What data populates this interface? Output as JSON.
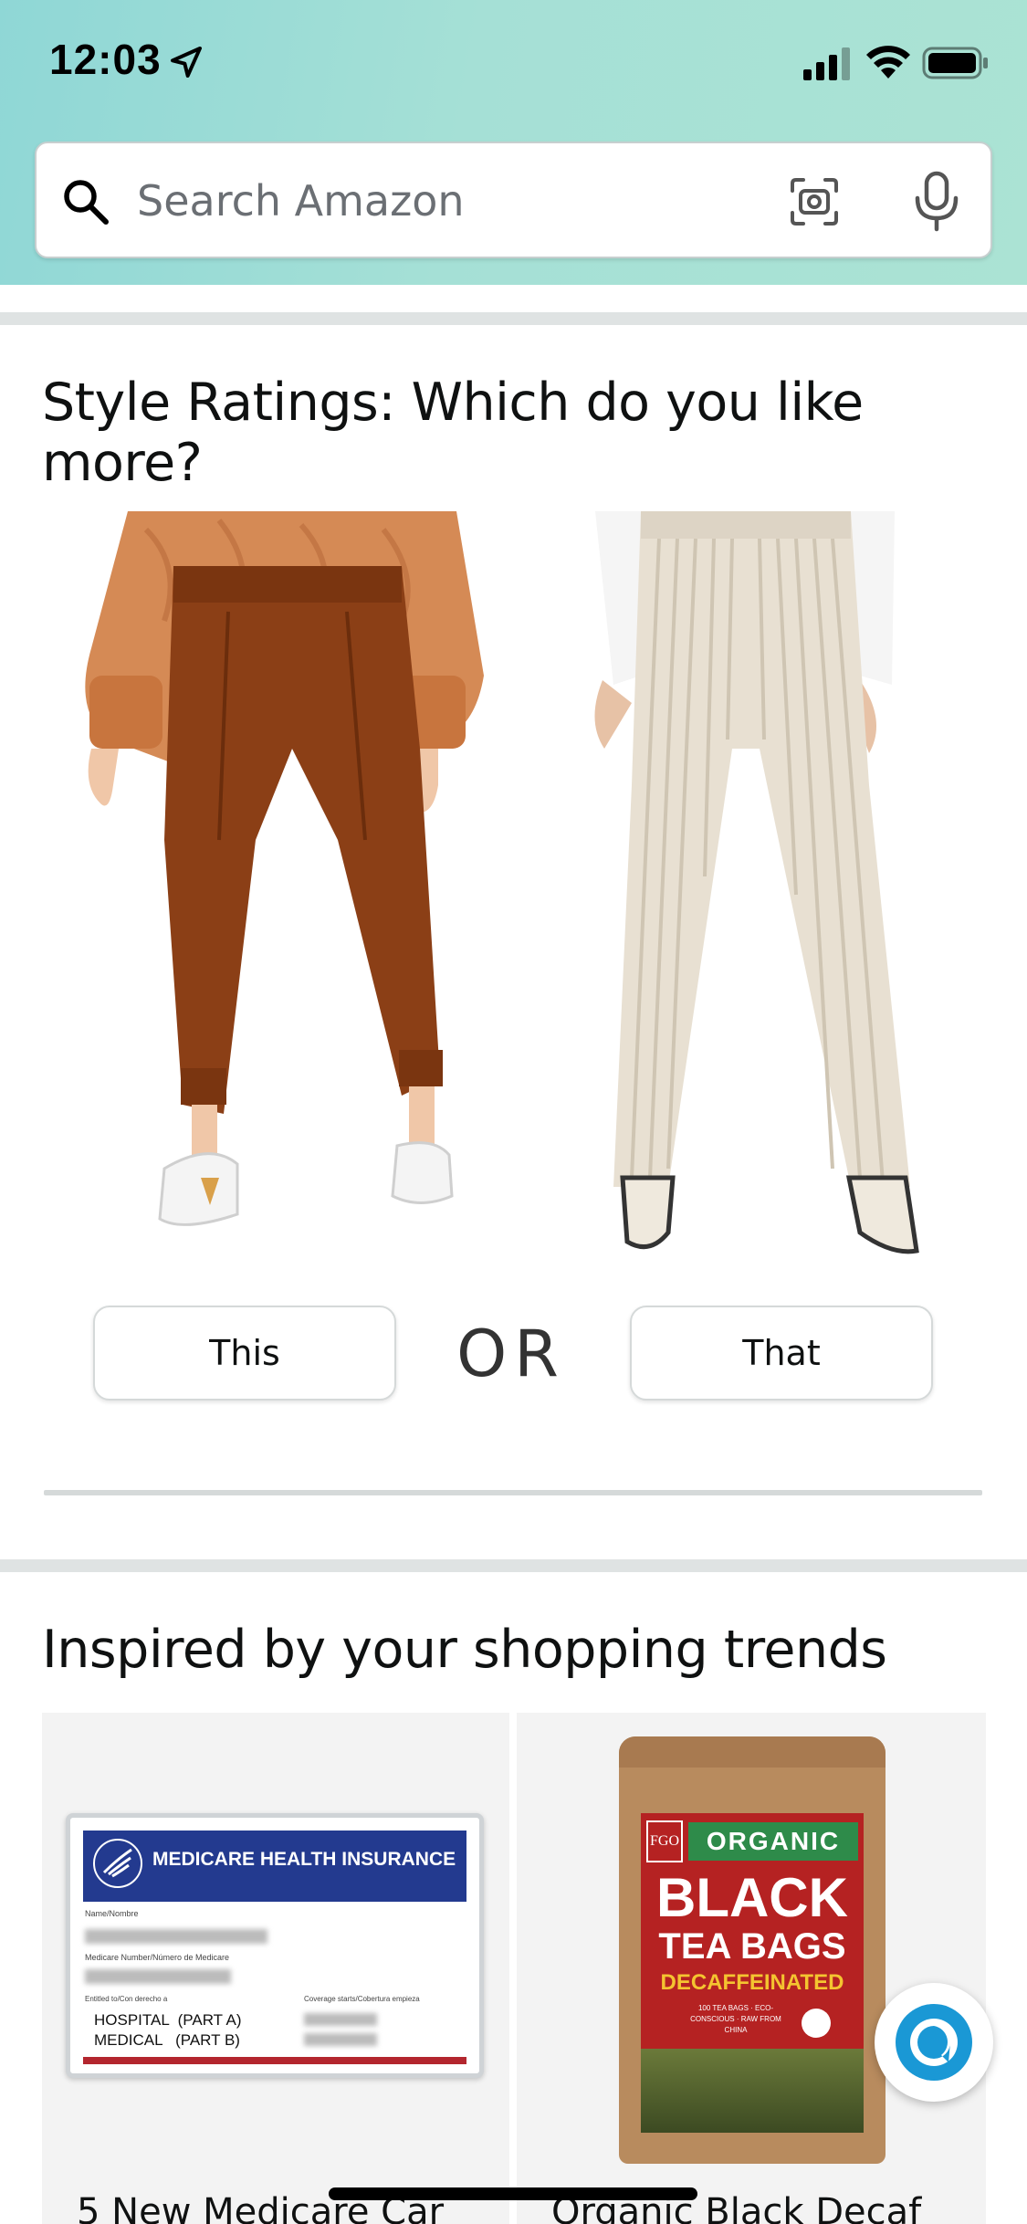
{
  "status_bar": {
    "time": "12:03"
  },
  "search": {
    "placeholder": "Search Amazon"
  },
  "style_ratings": {
    "title": "Style Ratings: Which do you like more?",
    "option_a_label": "This",
    "or_label": "OR",
    "option_b_label": "That"
  },
  "inspired": {
    "title": "Inspired by your shopping trends",
    "items": [
      {
        "caption": "5 New Medicare Car",
        "card_header": "MEDICARE HEALTH INSURANCE",
        "card_name_label": "Name/Nombre",
        "card_number_label": "Medicare Number/Número de Medicare",
        "card_entitled_label": "Entitled to/Con derecho a",
        "card_coverage_label": "Coverage starts/Cobertura empieza",
        "card_line1": "HOSPITAL  (PART A)",
        "card_line2": "MEDICAL   (PART B)"
      },
      {
        "caption": "Organic Black Decaf",
        "bag_brand": "FGO",
        "bag_line1": "ORGANIC",
        "bag_line2": "BLACK",
        "bag_line3": "TEA BAGS",
        "bag_line4": "DECAFFEINATED",
        "bag_small": "100 TEA BAGS · ECO-CONSCIOUS · RAW FROM CHINA"
      }
    ]
  },
  "colors": {
    "header_gradient_start": "#8fd7d6",
    "header_gradient_end": "#abe3d4",
    "pants_brown": "#8b3f16",
    "pants_cream": "#e8e0d2",
    "alexa_blue": "#1a98d5"
  },
  "icons": [
    "location-arrow-icon",
    "signal-icon",
    "wifi-icon",
    "battery-icon",
    "search-icon",
    "camera-icon",
    "microphone-icon",
    "alexa-icon"
  ]
}
